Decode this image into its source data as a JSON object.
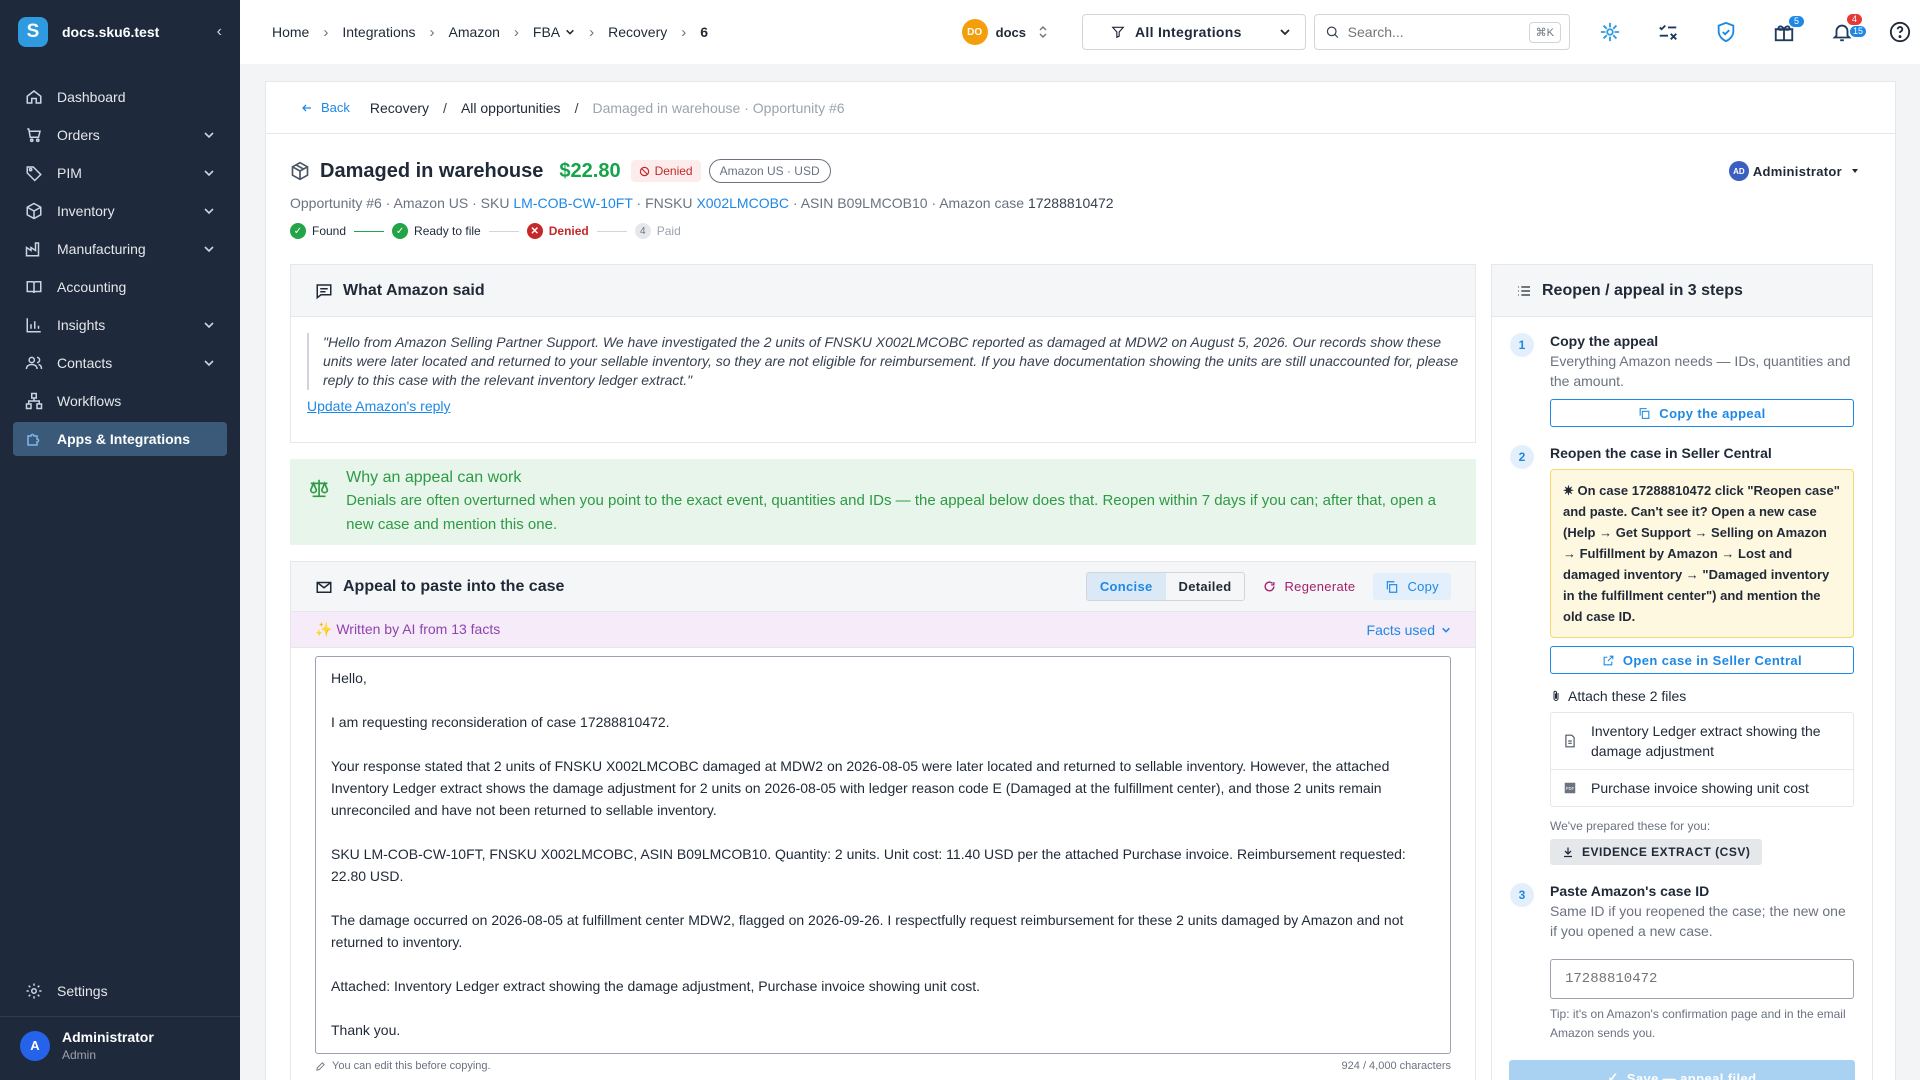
{
  "sidebar": {
    "logo": "S",
    "workspace": "docs.sku6.test",
    "items": [
      {
        "label": "Dashboard"
      },
      {
        "label": "Orders"
      },
      {
        "label": "PIM"
      },
      {
        "label": "Inventory"
      },
      {
        "label": "Manufacturing"
      },
      {
        "label": "Accounting"
      },
      {
        "label": "Insights"
      },
      {
        "label": "Contacts"
      },
      {
        "label": "Workflows"
      },
      {
        "label": "Apps & Integrations"
      }
    ],
    "settings": "Settings",
    "user": {
      "initial": "A",
      "name": "Administrator",
      "role": "Admin"
    }
  },
  "topbar": {
    "breadcrumbs": [
      "Home",
      "Integrations",
      "Amazon",
      "FBA",
      "Recovery",
      "6"
    ],
    "docs_initials": "DO",
    "docs_label": "docs",
    "filter_label": "All Integrations",
    "search_placeholder": "Search...",
    "search_kbd": "⌘K",
    "gift_badge": "5",
    "notif_badge_red": "4",
    "notif_badge_blue": "15"
  },
  "page": {
    "back": "Back",
    "crumbs": [
      "Recovery",
      "All opportunities"
    ],
    "crumb_current": "Damaged in warehouse · Opportunity #6",
    "title": "Damaged in warehouse",
    "amount": "$22.80",
    "status": "Denied",
    "marketplace": "Amazon US · USD",
    "admin_initials": "AD",
    "admin_label": "Administrator",
    "meta": {
      "opportunity": "Opportunity #6",
      "market": "Amazon US",
      "sku_label": "SKU",
      "sku": "LM-COB-CW-10FT",
      "fnsku_label": "FNSKU",
      "fnsku": "X002LMCOBC",
      "asin": "ASIN B09LMCOB10",
      "case_label": "Amazon case",
      "case_id": "17288810472"
    },
    "steps": [
      "Found",
      "Ready to file",
      "Denied",
      "Paid"
    ],
    "steps_paid_num": "4",
    "colors": {
      "ok": "#22a447",
      "denied": "#c62828",
      "link": "#1e88e5"
    }
  },
  "amazon_said": {
    "heading": "What Amazon said",
    "quote": "\"Hello from Amazon Selling Partner Support. We have investigated the 2 units of FNSKU X002LMCOBC reported as damaged at MDW2 on August 5, 2026. Our records show these units were later located and returned to your sellable inventory, so they are not eligible for reimbursement. If you have documentation showing the units are still unaccounted for, please reply to this case with the relevant inventory ledger extract.\"",
    "update_link": "Update Amazon's reply"
  },
  "why": {
    "heading": "Why an appeal can work",
    "body": "Denials are often overturned when you point to the exact event, quantities and IDs — the appeal below does that. Reopen within 7 days if you can; after that, open a new case and mention this one."
  },
  "appeal": {
    "heading": "Appeal to paste into the case",
    "toggle": [
      "Concise",
      "Detailed"
    ],
    "regenerate": "Regenerate",
    "copy": "Copy",
    "ai_note": "✨ Written by AI from 13 facts",
    "facts_used": "Facts used",
    "paragraphs": [
      "Hello,",
      "I am requesting reconsideration of case 17288810472.",
      "Your response stated that 2 units of FNSKU X002LMCOBC damaged at MDW2 on 2026-08-05 were later located and returned to sellable inventory. However, the attached Inventory Ledger extract shows the damage adjustment for 2 units on 2026-08-05 with ledger reason code E (Damaged at the fulfillment center), and those 2 units remain unreconciled and have not been returned to sellable inventory.",
      "SKU LM-COB-CW-10FT, FNSKU X002LMCOBC, ASIN B09LMCOB10. Quantity: 2 units. Unit cost: 11.40 USD per the attached Purchase invoice. Reimbursement requested: 22.80 USD.",
      "The damage occurred on 2026-08-05 at fulfillment center MDW2, flagged on 2026-09-26. I respectfully request reimbursement for these 2 units damaged by Amazon and not returned to inventory.",
      "Attached: Inventory Ledger extract showing the damage adjustment, Purchase invoice showing unit cost.",
      "Thank you."
    ],
    "edit_hint": "You can edit this before copying.",
    "char_count": "924 / 4,000 characters"
  },
  "reopen": {
    "heading": "Reopen / appeal in 3 steps",
    "step1": {
      "num": "1",
      "title": "Copy the appeal",
      "desc": "Everything Amazon needs — IDs, quantities and the amount.",
      "button": "Copy the appeal"
    },
    "step2": {
      "num": "2",
      "title": "Reopen the case in Seller Central",
      "instruction": "On case 17288810472 click \"Reopen case\" and paste. Can't see it? Open a new case (Help → Get Support → Selling on Amazon → Fulfillment by Amazon → Lost and damaged inventory → \"Damaged inventory in the fulfillment center\") and mention the old case ID.",
      "button": "Open case in Seller Central",
      "attach_heading": "Attach these 2 files",
      "files": [
        "Inventory Ledger extract showing the damage adjustment",
        "Purchase invoice showing unit cost"
      ],
      "prepared_note": "We've prepared these for you:",
      "download": "EVIDENCE EXTRACT (CSV)"
    },
    "step3": {
      "num": "3",
      "title": "Paste Amazon's case ID",
      "desc": "Same ID if you reopened the case; the new one if you opened a new case.",
      "placeholder": "17288810472",
      "tip": "Tip: it's on Amazon's confirmation page and in the email Amazon sends you."
    },
    "save": "Save — appeal filed"
  }
}
